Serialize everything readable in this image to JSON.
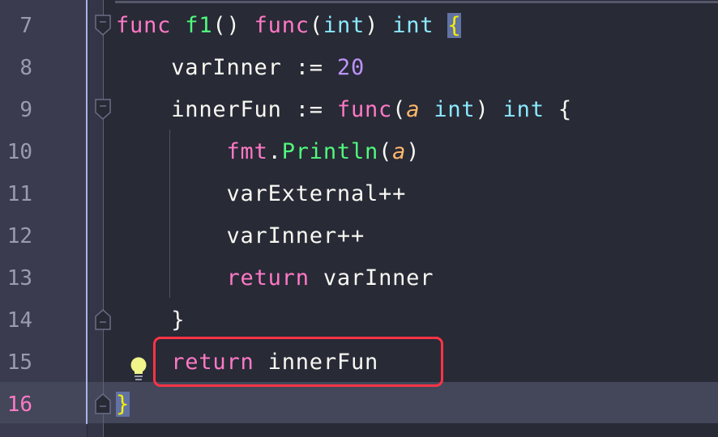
{
  "editor": {
    "current_line": 16,
    "colors": {
      "keyword": "#ff79c6",
      "function": "#50fa7b",
      "type": "#8be9fd",
      "number": "#bd93f9",
      "parameter": "#ffb86c",
      "brace": "#f4f000",
      "text": "#f8f8f2",
      "highlight_box": "#ff3445"
    },
    "lines": [
      {
        "n": "7",
        "tokens": [
          [
            "kw",
            "func"
          ],
          [
            "",
            " "
          ],
          [
            "fn",
            "f1"
          ],
          [
            "",
            "() "
          ],
          [
            "kw",
            "func"
          ],
          [
            "",
            "("
          ],
          [
            "ty",
            "int"
          ],
          [
            "",
            ") "
          ],
          [
            "ty",
            "int"
          ],
          [
            "",
            " "
          ],
          [
            "br br-hl",
            "{"
          ]
        ]
      },
      {
        "n": "8",
        "tokens": [
          [
            "",
            "    varInner := "
          ],
          [
            "num",
            "20"
          ]
        ]
      },
      {
        "n": "9",
        "tokens": [
          [
            "",
            "    innerFun := "
          ],
          [
            "kw",
            "func"
          ],
          [
            "",
            "("
          ],
          [
            "par",
            "a"
          ],
          [
            "",
            " "
          ],
          [
            "ty",
            "int"
          ],
          [
            "",
            ") "
          ],
          [
            "ty",
            "int"
          ],
          [
            "",
            " {"
          ]
        ]
      },
      {
        "n": "10",
        "tokens": [
          [
            "",
            "        "
          ],
          [
            "kw",
            "fmt"
          ],
          [
            "",
            "."
          ],
          [
            "fn",
            "Println"
          ],
          [
            "",
            "("
          ],
          [
            "par",
            "a"
          ],
          [
            "",
            ")"
          ]
        ]
      },
      {
        "n": "11",
        "tokens": [
          [
            "",
            "        varExternal++"
          ]
        ]
      },
      {
        "n": "12",
        "tokens": [
          [
            "",
            "        varInner++"
          ]
        ]
      },
      {
        "n": "13",
        "tokens": [
          [
            "",
            "        "
          ],
          [
            "kw",
            "return"
          ],
          [
            "",
            " varInner"
          ]
        ]
      },
      {
        "n": "14",
        "tokens": [
          [
            "",
            "    }"
          ]
        ]
      },
      {
        "n": "15",
        "tokens": [
          [
            "",
            "    "
          ],
          [
            "kw",
            "return"
          ],
          [
            "",
            " innerFun"
          ]
        ]
      },
      {
        "n": "16",
        "tokens": [
          [
            "br br-hl",
            "}"
          ]
        ]
      }
    ],
    "fold_markers": [
      {
        "line": "7",
        "icon": "fold-collapse-icon"
      },
      {
        "line": "9",
        "icon": "fold-collapse-icon"
      },
      {
        "line": "14",
        "icon": "fold-end-icon"
      },
      {
        "line": "16",
        "icon": "fold-end-icon"
      }
    ],
    "intention_icon": "lightbulb-icon"
  }
}
